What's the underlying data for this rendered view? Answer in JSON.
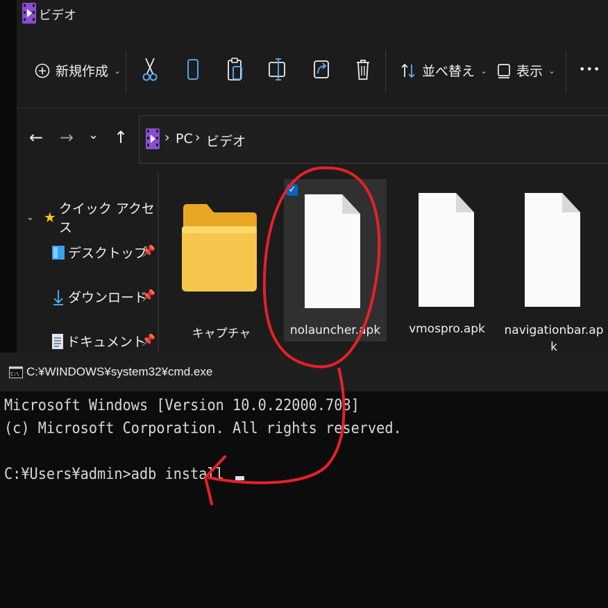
{
  "explorer": {
    "title": "ビデオ",
    "toolbar": {
      "new_label": "新規作成",
      "sort_label": "並べ替え",
      "view_label": "表示",
      "more_label": "•••"
    },
    "breadcrumb": [
      "PC",
      "ビデオ"
    ],
    "breadcrumb_sep": "›",
    "sidebar": {
      "quick_access": "クイック アクセス",
      "items": [
        "デスクトップ",
        "ダウンロード",
        "ドキュメント"
      ]
    },
    "files": [
      "キャプチャ",
      "nolauncher.apk",
      "vmospro.apk",
      "navigationbar.ap\nk"
    ],
    "checkmark": "✓"
  },
  "cmd": {
    "title": "C:¥WINDOWS¥system32¥cmd.exe",
    "lines": [
      "Microsoft Windows [Version 10.0.22000.708]",
      "(c) Microsoft Corporation. All rights reserved.",
      "",
      "C:¥Users¥admin>adb install "
    ]
  },
  "colors": {
    "accent": "#0067c0",
    "annotation": "#e8202a",
    "folder": "#f6c64c"
  }
}
